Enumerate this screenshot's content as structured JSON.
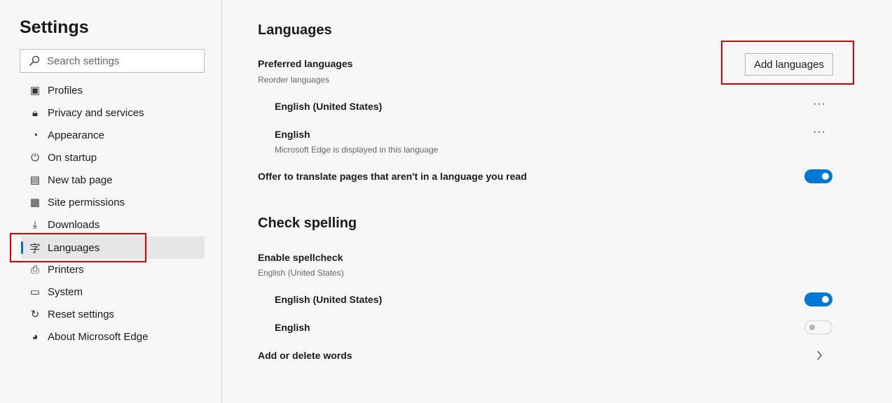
{
  "sidebar": {
    "title": "Settings",
    "search_placeholder": "Search settings",
    "items": [
      {
        "label": "Profiles",
        "icon": "profile-icon"
      },
      {
        "label": "Privacy and services",
        "icon": "lock-icon"
      },
      {
        "label": "Appearance",
        "icon": "palette-icon"
      },
      {
        "label": "On startup",
        "icon": "power-icon"
      },
      {
        "label": "New tab page",
        "icon": "new-tab-icon"
      },
      {
        "label": "Site permissions",
        "icon": "site-permissions-icon"
      },
      {
        "label": "Downloads",
        "icon": "download-icon"
      },
      {
        "label": "Languages",
        "icon": "languages-icon",
        "selected": true
      },
      {
        "label": "Printers",
        "icon": "printer-icon"
      },
      {
        "label": "System",
        "icon": "laptop-icon"
      },
      {
        "label": "Reset settings",
        "icon": "reset-icon"
      },
      {
        "label": "About Microsoft Edge",
        "icon": "edge-logo-icon"
      }
    ]
  },
  "languages": {
    "title": "Languages",
    "preferred_title": "Preferred languages",
    "preferred_sub": "Reorder languages",
    "add_button": "Add languages",
    "list": [
      {
        "name": "English (United States)",
        "sub": ""
      },
      {
        "name": "English",
        "sub": "Microsoft Edge is displayed in this language"
      }
    ],
    "translate_label": "Offer to translate pages that aren't in a language you read",
    "translate_on": true
  },
  "spelling": {
    "title": "Check spelling",
    "enable_label": "Enable spellcheck",
    "enable_sub": "English (United States)",
    "langs": [
      {
        "name": "English (United States)",
        "on": true
      },
      {
        "name": "English",
        "on": false
      }
    ],
    "add_words": "Add or delete words"
  },
  "colors": {
    "accent": "#0078d4",
    "highlight": "#e00000"
  }
}
